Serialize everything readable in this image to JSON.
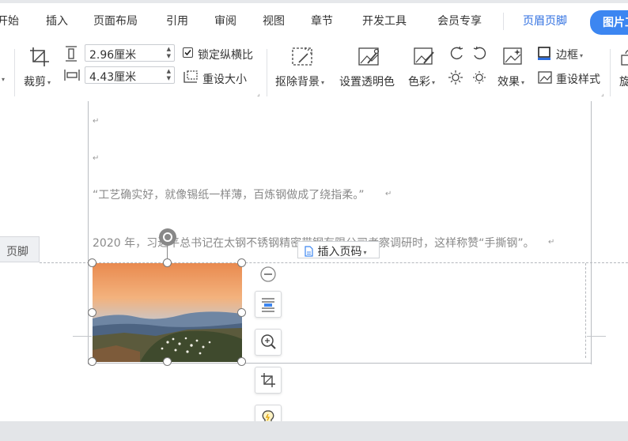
{
  "tabs": [
    {
      "key": "home",
      "label": "开始"
    },
    {
      "key": "insert",
      "label": "插入"
    },
    {
      "key": "layout",
      "label": "页面布局"
    },
    {
      "key": "references",
      "label": "引用"
    },
    {
      "key": "review",
      "label": "审阅"
    },
    {
      "key": "view",
      "label": "视图"
    },
    {
      "key": "sections",
      "label": "章节"
    },
    {
      "key": "developer",
      "label": "开发工具"
    },
    {
      "key": "member",
      "label": "会员专享"
    },
    {
      "key": "header_footer",
      "label": "页眉页脚"
    },
    {
      "key": "picture_tools",
      "label": "图片工"
    }
  ],
  "ribbon": {
    "crop_label": "裁剪",
    "height_value": "2.96厘米",
    "width_value": "4.43厘米",
    "lock_ratio_label": "锁定纵横比",
    "lock_ratio_checked": true,
    "reset_size_label": "重设大小",
    "remove_bg_label": "抠除背景",
    "set_transparent_label": "设置透明色",
    "color_label": "色彩",
    "effects_label": "效果",
    "border_label": "边框",
    "reset_style_label": "重设样式",
    "rotate_label": "旋"
  },
  "document": {
    "quote": "“工艺确实好，就像锡纸一样薄，百炼钢做成了绕指柔。”",
    "paragraph": "2020 年，习近平总书记在太钢不锈钢精密带钢有限公司考察调研时，这样称赞“手撕钢”。",
    "footer_tag": "页脚",
    "insert_page_number": "插入页码"
  },
  "colors": {
    "accent": "#3c86f1",
    "active_tab": "#2d6ee0"
  }
}
